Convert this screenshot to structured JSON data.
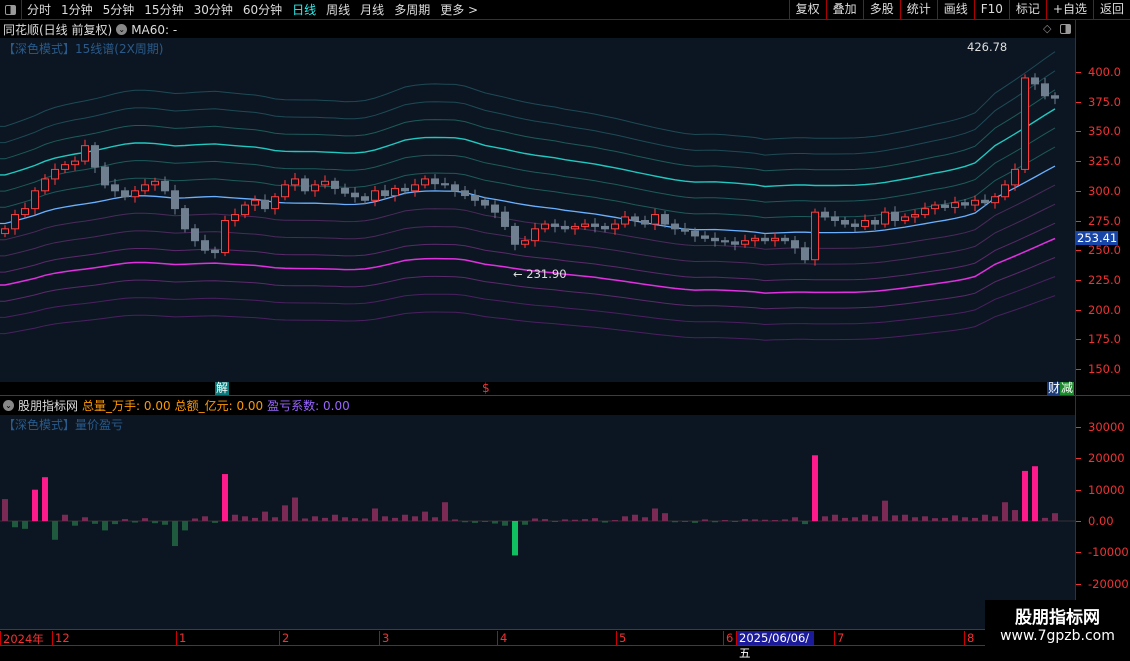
{
  "toolbar": {
    "periods": [
      "分时",
      "1分钟",
      "5分钟",
      "15分钟",
      "30分钟",
      "60分钟",
      "日线",
      "周线",
      "月线",
      "多周期",
      "更多 >"
    ],
    "active": "日线",
    "right_buttons": [
      "复权",
      "叠加",
      "多股",
      "统计",
      "画线",
      "F10",
      "标记",
      "+自选",
      "返回"
    ]
  },
  "info": {
    "title": "同花顺(日线 前复权)",
    "ma": "MA60: -"
  },
  "main": {
    "indicator_title": "【深色模式】15线谱(2X周期)",
    "high_label": "426.78",
    "low_label": "← 231.90",
    "last_price": "253.41",
    "y_ticks": [
      400,
      375,
      350,
      325,
      300,
      275,
      250,
      225,
      200,
      175,
      150
    ],
    "y_tick_labels": [
      "400.0",
      "375.0",
      "350.0",
      "325.0",
      "300.0",
      "275.0",
      "250.0",
      "225.0",
      "200.0",
      "175.0",
      "150.0"
    ],
    "markers": {
      "jie": "解",
      "dollar": "$",
      "cai": "财",
      "jian": "减"
    },
    "closes": [
      268,
      280,
      285,
      300,
      310,
      318,
      322,
      325,
      338,
      320,
      305,
      300,
      295,
      300,
      305,
      308,
      300,
      285,
      268,
      258,
      250,
      248,
      275,
      280,
      288,
      292,
      285,
      295,
      305,
      310,
      300,
      305,
      308,
      302,
      298,
      295,
      292,
      300,
      296,
      302,
      300,
      305,
      310,
      306,
      305,
      300,
      296,
      292,
      288,
      282,
      270,
      255,
      258,
      268,
      272,
      270,
      268,
      270,
      272,
      270,
      268,
      272,
      278,
      275,
      272,
      280,
      272,
      268,
      266,
      262,
      260,
      258,
      257,
      255,
      258,
      260,
      258,
      260,
      258,
      252,
      242,
      282,
      278,
      275,
      272,
      270,
      275,
      272,
      282,
      275,
      278,
      280,
      285,
      288,
      286,
      290,
      288,
      292,
      290,
      295,
      305,
      318,
      395,
      390,
      380,
      378
    ]
  },
  "indicator": {
    "name": "股朋指标网",
    "vol_label": "总量_万手: 0.00",
    "amt_label": "总额_亿元: 0.00",
    "coef_label": "盈亏系数: 0.00",
    "sub_title": "【深色模式】量价盈亏",
    "y_ticks": [
      30000,
      20000,
      10000,
      0,
      -10000,
      -20000
    ],
    "y_tick_labels": [
      "30000",
      "20000",
      "10000",
      "0.00",
      "-10000",
      "-20000"
    ],
    "values": [
      7000,
      -2000,
      -2500,
      10000,
      14000,
      -6000,
      2000,
      -1500,
      1200,
      -900,
      -3000,
      -1000,
      600,
      -500,
      900,
      -700,
      -1200,
      -8000,
      -3000,
      800,
      1500,
      -600,
      15000,
      2000,
      1500,
      1000,
      3000,
      1200,
      5000,
      7500,
      800,
      1500,
      1000,
      2000,
      1200,
      900,
      800,
      4000,
      1500,
      1000,
      2000,
      1500,
      3000,
      1200,
      6000,
      500,
      -400,
      -600,
      -300,
      -800,
      -1500,
      -11000,
      -1200,
      800,
      600,
      -300,
      500,
      400,
      600,
      900,
      -500,
      300,
      1500,
      2000,
      1200,
      4000,
      2500,
      -400,
      -300,
      -600,
      500,
      -400,
      300,
      -300,
      600,
      500,
      400,
      300,
      500,
      1200,
      -1000,
      21000,
      1500,
      2000,
      1000,
      1200,
      2000,
      1500,
      6500,
      1800,
      2000,
      1200,
      1500,
      900,
      1000,
      1800,
      1200,
      1000,
      2000,
      1500,
      6000,
      3500,
      16000,
      17500,
      1000,
      2500
    ]
  },
  "time_axis": [
    "2024年",
    "12",
    "1",
    "2",
    "3",
    "4",
    "5",
    "6",
    "2025/06/06/五",
    "7",
    "8"
  ],
  "watermark": {
    "name": "股朋指标网",
    "url": "www.7gpzb.com"
  }
}
